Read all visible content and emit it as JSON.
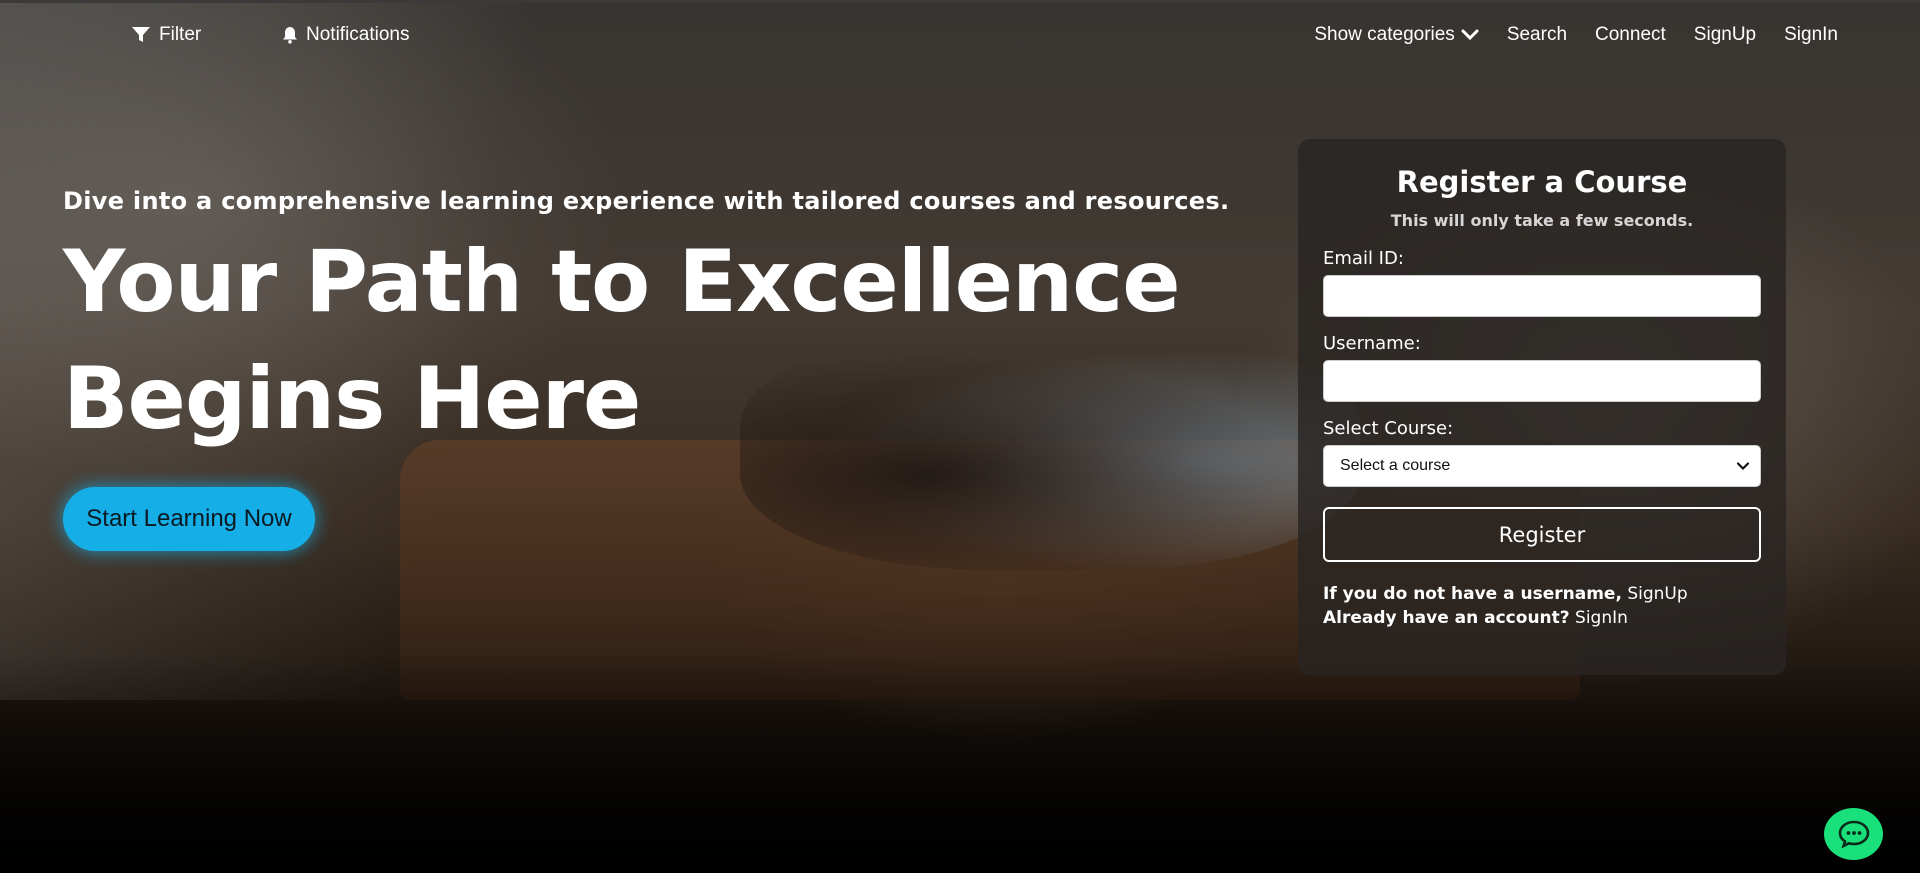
{
  "nav": {
    "filter_label": "Filter",
    "notifications_label": "Notifications",
    "show_categories_label": "Show categories",
    "search_label": "Search",
    "connect_label": "Connect",
    "signup_label": "SignUp",
    "signin_label": "SignIn"
  },
  "hero": {
    "subtitle": "Dive into a comprehensive learning experience with tailored courses and resources.",
    "title_line1": "Your Path to Excellence",
    "title_line2": "Begins Here",
    "cta_label": "Start Learning Now"
  },
  "register_card": {
    "title": "Register a Course",
    "subtitle": "This will only take a few seconds.",
    "email_label": "Email ID:",
    "email_value": "",
    "username_label": "Username:",
    "username_value": "",
    "course_label": "Select Course:",
    "course_selected": "Select a course",
    "register_label": "Register",
    "no_username_text": "If you do not have a username,",
    "signup_link": "SignUp",
    "have_account_text": "Already have an account?",
    "signin_link": "SignIn"
  },
  "colors": {
    "cta_blue": "#16aee6",
    "chat_green": "#19e07a",
    "card_bg": "#282422"
  },
  "icons": {
    "filter": "filter-icon",
    "bell": "bell-icon",
    "chevron": "chevron-down-icon",
    "chat": "chat-bubble-icon"
  }
}
